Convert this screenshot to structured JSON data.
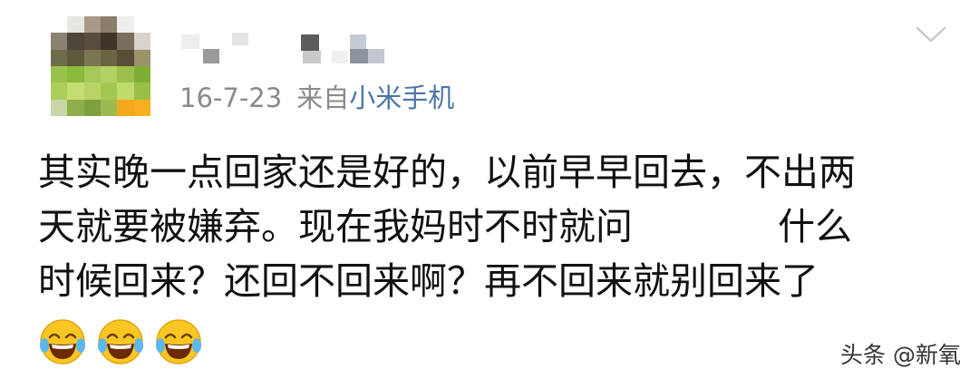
{
  "post": {
    "date": "16-7-23",
    "source_prefix": "来自",
    "device": "小米手机",
    "text_lines": [
      "其实晚一点回家还是好的，以前早早回去，不出两",
      "天就要被嫌弃。现在我妈时不时就问",
      "什么",
      "时候回来？还回不回来啊？再不回来就别回来了"
    ],
    "emojis": [
      "laughing-crying-emoji",
      "laughing-crying-emoji",
      "laughing-crying-emoji"
    ]
  },
  "watermark": "头条 @新氧",
  "icons": {
    "expand": "chevron-down-icon"
  },
  "colors": {
    "link": "#4a76a8",
    "meta": "#8a8a8a",
    "text": "#111111"
  }
}
